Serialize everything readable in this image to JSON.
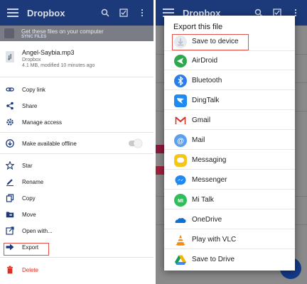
{
  "left": {
    "app_title": "Dropbox",
    "banner_text": "Get these files on your computer",
    "banner_link": "SYNC FILES",
    "file": {
      "name": "Angel-Saybia.mp3",
      "location": "Dropbox",
      "meta": "4.1 MB, modified 10 minutes ago"
    },
    "menu": {
      "copy_link": "Copy link",
      "share": "Share",
      "manage_access": "Manage access",
      "offline": "Make available offline",
      "star": "Star",
      "rename": "Rename",
      "copy": "Copy",
      "move": "Move",
      "open_with": "Open with...",
      "export": "Export",
      "delete": "Delete"
    }
  },
  "right": {
    "app_title": "Dropbox",
    "dialog_title": "Export this file",
    "options": [
      {
        "label": "Save to device",
        "icon": "download-icon"
      },
      {
        "label": "AirDroid",
        "icon": "airdroid-icon"
      },
      {
        "label": "Bluetooth",
        "icon": "bluetooth-icon"
      },
      {
        "label": "DingTalk",
        "icon": "dingtalk-icon"
      },
      {
        "label": "Gmail",
        "icon": "gmail-icon"
      },
      {
        "label": "Mail",
        "icon": "mail-icon"
      },
      {
        "label": "Messaging",
        "icon": "messaging-icon"
      },
      {
        "label": "Messenger",
        "icon": "messenger-icon"
      },
      {
        "label": "Mi Talk",
        "icon": "mitalk-icon"
      },
      {
        "label": "OneDrive",
        "icon": "onedrive-icon"
      },
      {
        "label": "Play with VLC",
        "icon": "vlc-icon"
      },
      {
        "label": "Save to Drive",
        "icon": "drive-icon"
      }
    ]
  },
  "colors": {
    "appbar": "#1c3a7a",
    "accent_blue": "#0061fe",
    "delete_red": "#d93025",
    "highlight": "#e0524a"
  }
}
